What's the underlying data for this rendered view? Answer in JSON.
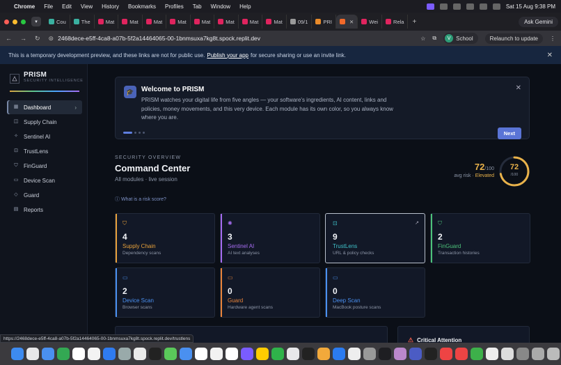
{
  "menubar": {
    "app": "Chrome",
    "items": [
      "File",
      "Edit",
      "View",
      "History",
      "Bookmarks",
      "Profiles",
      "Tab",
      "Window",
      "Help"
    ],
    "clock": "Sat 15 Aug  9:38 PM"
  },
  "browser": {
    "tabs": [
      {
        "label": "Cou"
      },
      {
        "label": "The"
      },
      {
        "label": "Mat"
      },
      {
        "label": "Mat"
      },
      {
        "label": "Mat"
      },
      {
        "label": "Mat"
      },
      {
        "label": "Mat"
      },
      {
        "label": "Mat"
      },
      {
        "label": "Mat"
      },
      {
        "label": "Mat"
      },
      {
        "label": "09/1"
      },
      {
        "label": "PRI"
      },
      {
        "label": ""
      },
      {
        "label": "Wei"
      },
      {
        "label": "Rela"
      }
    ],
    "ask_gemini": "Ask Gemini",
    "url": "2468dece-e5ff-4ca8-a07b-5f2a14464065-00-1bnmsuxa7kg8t.spock.replit.dev",
    "profile_initial": "V",
    "profile_name": "School",
    "relaunch": "Relaunch to update",
    "status_url": "https://2468dece-e5ff-4ca8-a07b-5f2a14464065-00-1bnmsuxa7kg8t.spock.replit.dev/trustlens"
  },
  "banner": {
    "text_before": "This is a temporary development preview, and these links are not for public use.",
    "link": "Publish your app",
    "text_after": "for secure sharing or use an invite link."
  },
  "sidebar": {
    "brand": "PRISM",
    "tagline": "SECURITY INTELLIGENCE",
    "items": [
      {
        "label": "Dashboard",
        "icon": "grid-icon"
      },
      {
        "label": "Supply Chain",
        "icon": "package-icon"
      },
      {
        "label": "Sentinel AI",
        "icon": "sparkle-icon"
      },
      {
        "label": "TrustLens",
        "icon": "lock-icon"
      },
      {
        "label": "FinGuard",
        "icon": "shield-icon"
      },
      {
        "label": "Device Scan",
        "icon": "monitor-icon"
      },
      {
        "label": "Guard",
        "icon": "guard-icon"
      },
      {
        "label": "Reports",
        "icon": "file-icon"
      }
    ]
  },
  "welcome": {
    "title": "Welcome to PRISM",
    "body": "PRISM watches your digital life from five angles — your software's ingredients, AI content, links and policies, money movements, and this very device. Each module has its own color, so you always know where you are.",
    "next": "Next"
  },
  "overview": {
    "kicker": "SECURITY OVERVIEW",
    "title": "Command Center",
    "subtitle": "All modules · live session",
    "risk_link": "What is a risk score?",
    "score": "72",
    "score_max": "/100",
    "avg_label": "avg risk ·",
    "level": "Elevated",
    "gauge_value": "72",
    "gauge_den": "/100",
    "gauge_fraction": 0.72,
    "accent": "#e9b24a"
  },
  "cards": [
    {
      "count": "4",
      "name": "Supply Chain",
      "desc": "Dependency scans",
      "color": "#e9a23b"
    },
    {
      "count": "3",
      "name": "Sentinel AI",
      "desc": "AI text analyses",
      "color": "#a56cf0"
    },
    {
      "count": "9",
      "name": "TrustLens",
      "desc": "URL & policy checks",
      "color": "#3fc1c9"
    },
    {
      "count": "2",
      "name": "FinGuard",
      "desc": "Transaction histories",
      "color": "#4cc27a"
    },
    {
      "count": "2",
      "name": "Device Scan",
      "desc": "Browser scans",
      "color": "#4a90f0"
    },
    {
      "count": "0",
      "name": "Guard",
      "desc": "Hardware agent scans",
      "color": "#e8833a"
    },
    {
      "count": "0",
      "name": "Deep Scan",
      "desc": "MacBook posture scans",
      "color": "#4a90f0"
    }
  ],
  "critical": {
    "title": "Critical Attention"
  }
}
